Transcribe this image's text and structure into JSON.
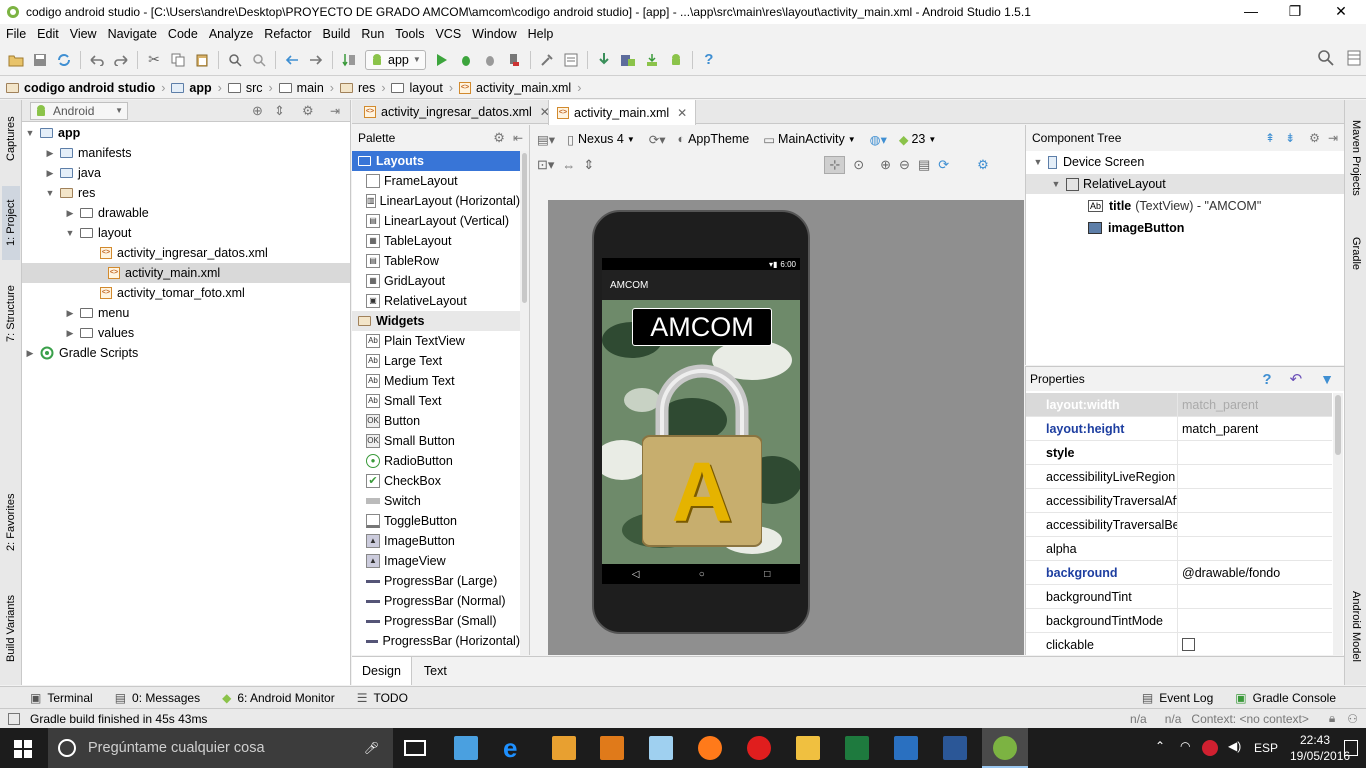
{
  "window": {
    "title": "codigo android studio - [C:\\Users\\andre\\Desktop\\PROYECTO DE GRADO AMCOM\\amcom\\codigo android studio] - [app] - ...\\app\\src\\main\\res\\layout\\activity_main.xml - Android Studio 1.5.1"
  },
  "menu": [
    "File",
    "Edit",
    "View",
    "Navigate",
    "Code",
    "Analyze",
    "Refactor",
    "Build",
    "Run",
    "Tools",
    "VCS",
    "Window",
    "Help"
  ],
  "toolbar": {
    "run_config": "app"
  },
  "breadcrumb": [
    "codigo android studio",
    "app",
    "src",
    "main",
    "res",
    "layout",
    "activity_main.xml"
  ],
  "left_tabs": {
    "captures": "Captures",
    "project": "1: Project",
    "structure": "7: Structure",
    "favorites": "2: Favorites",
    "build_variants": "Build Variants"
  },
  "right_tabs": {
    "maven": "Maven Projects",
    "gradle": "Gradle",
    "android_model": "Android Model"
  },
  "project": {
    "view": "Android",
    "tree": [
      "app",
      "manifests",
      "java",
      "res",
      "drawable",
      "layout",
      "activity_ingresar_datos.xml",
      "activity_main.xml",
      "activity_tomar_foto.xml",
      "menu",
      "values",
      "Gradle Scripts"
    ]
  },
  "editor": {
    "tabs": [
      "activity_ingresar_datos.xml",
      "activity_main.xml"
    ]
  },
  "palette": {
    "title": "Palette",
    "items": [
      "Layouts",
      "FrameLayout",
      "LinearLayout (Horizontal)",
      "LinearLayout (Vertical)",
      "TableLayout",
      "TableRow",
      "GridLayout",
      "RelativeLayout",
      "Widgets",
      "Plain TextView",
      "Large Text",
      "Medium Text",
      "Small Text",
      "Button",
      "Small Button",
      "RadioButton",
      "CheckBox",
      "Switch",
      "ToggleButton",
      "ImageButton",
      "ImageView",
      "ProgressBar (Large)",
      "ProgressBar (Normal)",
      "ProgressBar (Small)",
      "ProgressBar (Horizontal)"
    ]
  },
  "designer": {
    "device": "Nexus 4",
    "theme": "AppTheme",
    "activity": "MainActivity",
    "api": "23"
  },
  "phone": {
    "time": "6:00",
    "app_title": "AMCOM",
    "screen_title": "AMCOM",
    "lock_letter": "A"
  },
  "component_tree": {
    "title": "Component Tree",
    "root": "Device Screen",
    "layout": "RelativeLayout",
    "child1_name": "title",
    "child1_detail": "(TextView) - \"AMCOM\"",
    "child2": "imageButton"
  },
  "properties": {
    "title": "Properties",
    "rows": [
      [
        "layout:width",
        "match_parent"
      ],
      [
        "layout:height",
        "match_parent"
      ],
      [
        "style",
        ""
      ],
      [
        "accessibilityLiveRegion",
        ""
      ],
      [
        "accessibilityTraversalAfte",
        ""
      ],
      [
        "accessibilityTraversalBefc",
        ""
      ],
      [
        "alpha",
        ""
      ],
      [
        "background",
        "@drawable/fondo"
      ],
      [
        "backgroundTint",
        ""
      ],
      [
        "backgroundTintMode",
        ""
      ],
      [
        "clickable",
        ""
      ]
    ]
  },
  "bottom_tabs": [
    "Design",
    "Text"
  ],
  "tool_windows": {
    "terminal": "Terminal",
    "messages": "0: Messages",
    "android_monitor": "6: Android Monitor",
    "todo": "TODO",
    "event_log": "Event Log",
    "gradle_console": "Gradle Console"
  },
  "status": {
    "message": "Gradle build finished in 45s 43ms",
    "na1": "n/a",
    "na2": "n/a",
    "context": "Context: <no context>"
  },
  "taskbar": {
    "search": "Pregúntame cualquier cosa",
    "lang": "ESP",
    "time": "22:43",
    "date": "19/05/2016"
  }
}
